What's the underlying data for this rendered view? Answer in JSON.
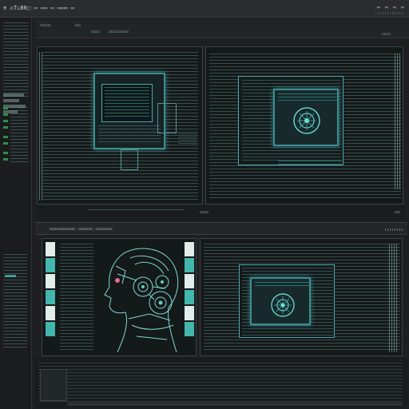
{
  "app": {
    "title_prefix": "≡ ⌂ ☐",
    "title_text": "T.86",
    "menu_placeholder": "□ ▭ ▭▭ ▭ ▭▭▭ ▭"
  },
  "window_controls": [
    "▭",
    "▭",
    "▭",
    "▭"
  ],
  "toolbar": {
    "buttons": [
      "▭▭▭▭",
      "▭▭",
      "▭▭▭",
      "▭▭▭▭▭▭▭"
    ],
    "right_label": "▭▭▭"
  },
  "top_region": {
    "status_left": "▭▭▭",
    "status_right": "▭▭"
  },
  "bottom_region": {
    "header_title": "▭▭▭▭▭▭▭▭▭ ▭▭▭▭▭ ▭▭▭▭▭▭"
  },
  "icons": {
    "menu": "menu-icon",
    "home": "home-icon",
    "window": "window-icon",
    "close": "close-icon",
    "portrait": "ai-portrait-figure"
  },
  "colors": {
    "background": "#1d1f21",
    "accent_teal": "#3c8e94",
    "bright_teal": "#4ec9c0",
    "status_green": "#2f8f4a",
    "panel": "#15191a"
  }
}
